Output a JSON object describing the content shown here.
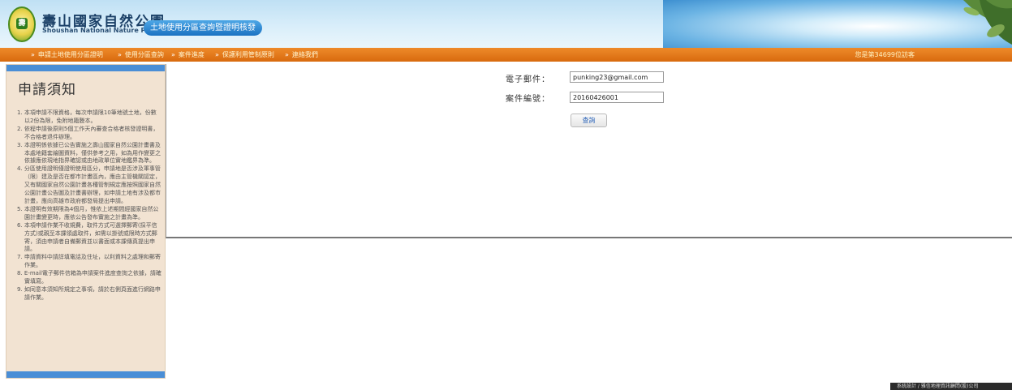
{
  "header": {
    "park_name": "壽山國家自然公園",
    "park_name_en": "Shoushan National Nature Park",
    "system_title": "土地使用分區查詢暨證明核發",
    "logo_text": "壽"
  },
  "nav": {
    "items": [
      "申請土地使用分區證明",
      "使用分區查詢",
      "案件進度",
      "保護利用管制原則",
      "連絡我們"
    ],
    "arrow": "»",
    "visitor_text": "您是第34699位訪客"
  },
  "sidebar": {
    "title": "申請須知",
    "items": [
      "1. 本項申請不限資格，每次申請限10筆地號土地，份數以2份為限，免附地籍謄本。",
      "2. 依程申請後原則5個工作天內審查合格者核發證明書，不合格者退件辦理。",
      "3. 本證明係依據已公告實施之壽山國家自然公園計畫書及本處地籍套繪圖資料，僅供參考之用，如為用作變更之依據應依現地指界確認或由地政單位實地鑑界為準。",
      "4. 分區使用證明僅證明使用區分，申請地是否涉及軍事管（限）建及是否在都市計畫區內，應由主管機關認定，又有關國家自然公園計畫各種管制規定應按照國家自然公園計畫公告圖及計畫書辦理，如申請土地有涉及都市計畫，應向高雄市政府都發局提出申請。",
      "5. 本證明有效期限為4個月，惟依上述期間經國家自然公園計畫變更時，應依公告發布實施之計畫為準。",
      "6. 本項申請作業不收規費，取件方式可選擇郵寄(採平信方式)或親至本課領處取件，如需以掛號或限時方式郵寄，須由申請者自備郵資並以書面或本課傳真提出申請。",
      "7. 申請資料中請詳填電話及住址，以利資料之處理和郵寄作業。",
      "8. E-mail電子郵件信箱為申請案件進度查詢之依據，請確實填寫。",
      "9. 如同意本須知所規定之事項，請於右側頁面進行網路申請作業。"
    ]
  },
  "form": {
    "email_label": "電子郵件：",
    "email_value": "punking23@gmail.com",
    "case_label": "案件編號：",
    "case_value": "20160426001",
    "query_button": "查詢"
  },
  "footer": {
    "text": "系統設計 / 雅信地理資訊顧問(股)公司"
  },
  "colors": {
    "nav_orange": "#e07518",
    "sidebar_bg": "#f2e3d2",
    "sidebar_bar_blue": "#4a8ed6",
    "title_pill_blue": "#1a72c2"
  }
}
